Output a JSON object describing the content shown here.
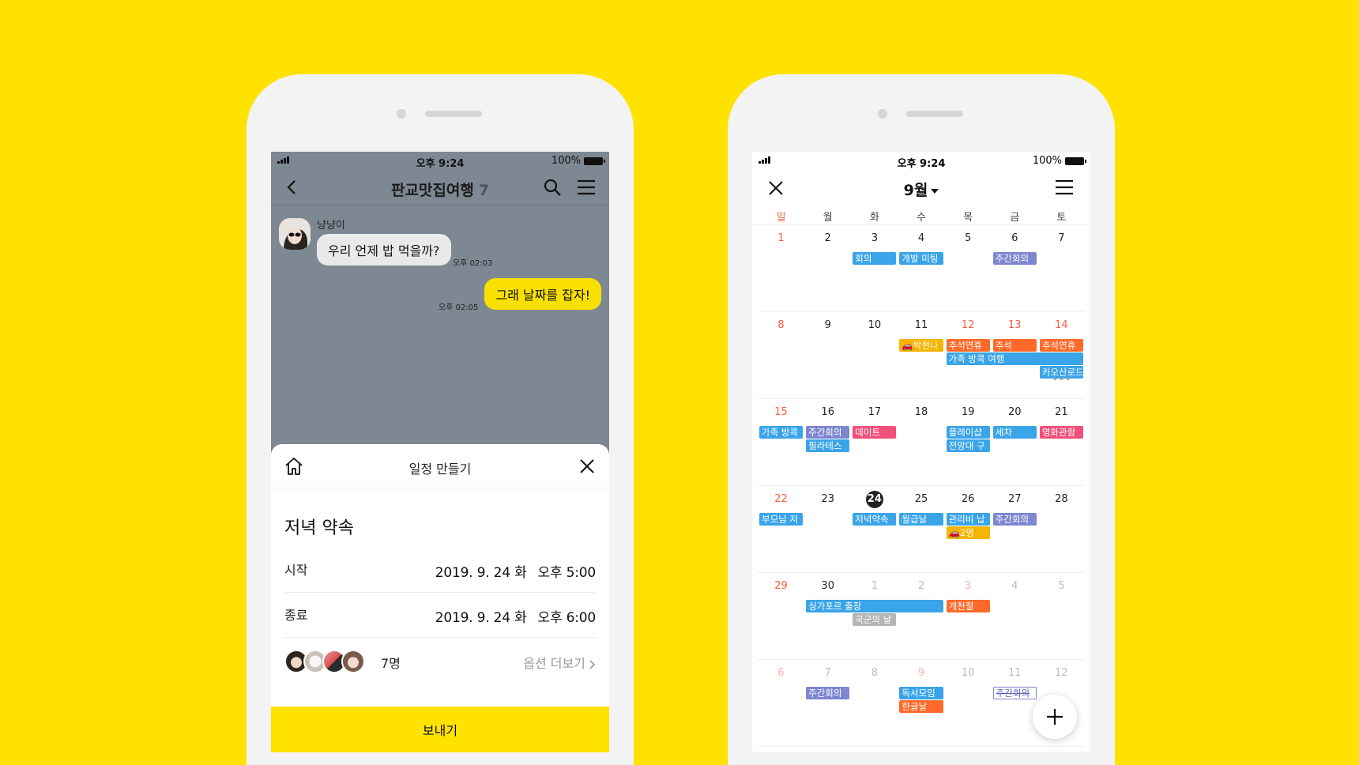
{
  "status_bar": {
    "time": "오후 9:24",
    "battery": "100%"
  },
  "chat": {
    "title": "판교맛집여행",
    "member_count": "7",
    "messages": [
      {
        "sender": "냥냥이",
        "text": "우리 언제 밥 먹을까?",
        "time": "오후 02:03",
        "direction": "in"
      },
      {
        "text": "그래 날짜를 잡자!",
        "time": "오후 02:05",
        "direction": "out"
      }
    ],
    "sheet": {
      "title": "일정 만들기",
      "event_title": "저녁 약속",
      "start_label": "시작",
      "start_date": "2019. 9. 24 화",
      "start_time": "오후 5:00",
      "end_label": "종료",
      "end_date": "2019. 9. 24 화",
      "end_time": "오후 6:00",
      "people_count": "7명",
      "more_options": "옵션 더보기",
      "send_label": "보내기"
    }
  },
  "calendar": {
    "month_label": "9월",
    "weekdays": [
      "일",
      "월",
      "화",
      "수",
      "목",
      "금",
      "토"
    ],
    "weeks": [
      {
        "days": [
          {
            "n": "1",
            "t": "sun"
          },
          {
            "n": "2"
          },
          {
            "n": "3"
          },
          {
            "n": "4"
          },
          {
            "n": "5"
          },
          {
            "n": "6"
          },
          {
            "n": "7"
          }
        ],
        "events": [
          {
            "label": "회의",
            "col": 2,
            "span": 1,
            "lane": 0,
            "color": "#3aa4e8"
          },
          {
            "label": "개발 미팅",
            "col": 3,
            "span": 1,
            "lane": 0,
            "color": "#3aa4e8"
          },
          {
            "label": "주간회의",
            "col": 5,
            "span": 1,
            "lane": 0,
            "color": "#7e86d0"
          }
        ]
      },
      {
        "days": [
          {
            "n": "8",
            "t": "sun"
          },
          {
            "n": "9"
          },
          {
            "n": "10"
          },
          {
            "n": "11"
          },
          {
            "n": "12",
            "t": "hol"
          },
          {
            "n": "13",
            "t": "hol"
          },
          {
            "n": "14",
            "t": "hol"
          }
        ],
        "events": [
          {
            "label": "🚗박현나",
            "col": 3,
            "span": 1,
            "lane": 0,
            "color": "#f4b400"
          },
          {
            "label": "추석연휴",
            "col": 4,
            "span": 1,
            "lane": 0,
            "color": "#ff6a2b"
          },
          {
            "label": "추석",
            "col": 5,
            "span": 1,
            "lane": 0,
            "color": "#ff6a2b"
          },
          {
            "label": "추석연휴",
            "col": 6,
            "span": 1,
            "lane": 0,
            "color": "#ff6a2b"
          },
          {
            "label": "가족 방콕 여행",
            "col": 4,
            "span": 3,
            "lane": 1,
            "color": "#3aa4e8"
          },
          {
            "label": "카오산로드",
            "col": 6,
            "span": 1,
            "lane": 2,
            "color": "#3aa4e8"
          }
        ],
        "more": "•••"
      },
      {
        "days": [
          {
            "n": "15",
            "t": "sun"
          },
          {
            "n": "16"
          },
          {
            "n": "17"
          },
          {
            "n": "18"
          },
          {
            "n": "19"
          },
          {
            "n": "20"
          },
          {
            "n": "21"
          }
        ],
        "events": [
          {
            "label": "가족 방콕",
            "col": 0,
            "span": 1,
            "lane": 0,
            "color": "#3aa4e8"
          },
          {
            "label": "주간회의",
            "col": 1,
            "span": 1,
            "lane": 0,
            "color": "#7e86d0"
          },
          {
            "label": "데이트",
            "col": 2,
            "span": 1,
            "lane": 0,
            "color": "#f0507a"
          },
          {
            "label": "플레이샵",
            "col": 4,
            "span": 1,
            "lane": 0,
            "color": "#3aa4e8"
          },
          {
            "label": "세차",
            "col": 5,
            "span": 1,
            "lane": 0,
            "color": "#3aa4e8"
          },
          {
            "label": "영화관람",
            "col": 6,
            "span": 1,
            "lane": 0,
            "color": "#f0507a"
          },
          {
            "label": "필라테스",
            "col": 1,
            "span": 1,
            "lane": 1,
            "color": "#3aa4e8"
          },
          {
            "label": "전망대 구",
            "col": 4,
            "span": 1,
            "lane": 1,
            "color": "#3aa4e8"
          }
        ]
      },
      {
        "days": [
          {
            "n": "22",
            "t": "sun"
          },
          {
            "n": "23"
          },
          {
            "n": "24",
            "t": "today"
          },
          {
            "n": "25"
          },
          {
            "n": "26"
          },
          {
            "n": "27"
          },
          {
            "n": "28"
          }
        ],
        "events": [
          {
            "label": "부모님 저",
            "col": 0,
            "span": 1,
            "lane": 0,
            "color": "#3aa4e8"
          },
          {
            "label": "저녁약속",
            "col": 2,
            "span": 1,
            "lane": 0,
            "color": "#3aa4e8"
          },
          {
            "label": "월급날",
            "col": 3,
            "span": 1,
            "lane": 0,
            "color": "#3aa4e8"
          },
          {
            "label": "관리비 납",
            "col": 4,
            "span": 1,
            "lane": 0,
            "color": "#3aa4e8"
          },
          {
            "label": "주간회의",
            "col": 5,
            "span": 1,
            "lane": 0,
            "color": "#7e86d0"
          },
          {
            "label": "🚗2명",
            "col": 4,
            "span": 1,
            "lane": 1,
            "color": "#f4b400"
          }
        ]
      },
      {
        "days": [
          {
            "n": "29",
            "t": "sun"
          },
          {
            "n": "30"
          },
          {
            "n": "1",
            "t": "dim"
          },
          {
            "n": "2",
            "t": "dim"
          },
          {
            "n": "3",
            "t": "dim sun"
          },
          {
            "n": "4",
            "t": "dim"
          },
          {
            "n": "5",
            "t": "dim"
          }
        ],
        "events": [
          {
            "label": "싱가포르 출장",
            "col": 1,
            "span": 3,
            "lane": 0,
            "color": "#3aa4e8"
          },
          {
            "label": "개천절",
            "col": 4,
            "span": 1,
            "lane": 0,
            "color": "#ff6a2b"
          },
          {
            "label": "국군의 날",
            "col": 2,
            "span": 1,
            "lane": 1,
            "color": "#b5b5b5"
          }
        ]
      },
      {
        "days": [
          {
            "n": "6",
            "t": "dim sun"
          },
          {
            "n": "7",
            "t": "dim"
          },
          {
            "n": "8",
            "t": "dim"
          },
          {
            "n": "9",
            "t": "dim sun"
          },
          {
            "n": "10",
            "t": "dim"
          },
          {
            "n": "11",
            "t": "dim"
          },
          {
            "n": "12",
            "t": "dim"
          }
        ],
        "events": [
          {
            "label": "주간회의",
            "col": 1,
            "span": 1,
            "lane": 0,
            "color": "#7e86d0"
          },
          {
            "label": "독서모임",
            "col": 3,
            "span": 1,
            "lane": 0,
            "color": "#3aa4e8"
          },
          {
            "label": "주간회의",
            "col": 5,
            "span": 1,
            "lane": 0,
            "color": "#7e86d0",
            "style": "outline"
          },
          {
            "label": "한글날",
            "col": 3,
            "span": 1,
            "lane": 1,
            "color": "#ff6a2b"
          }
        ]
      }
    ]
  }
}
